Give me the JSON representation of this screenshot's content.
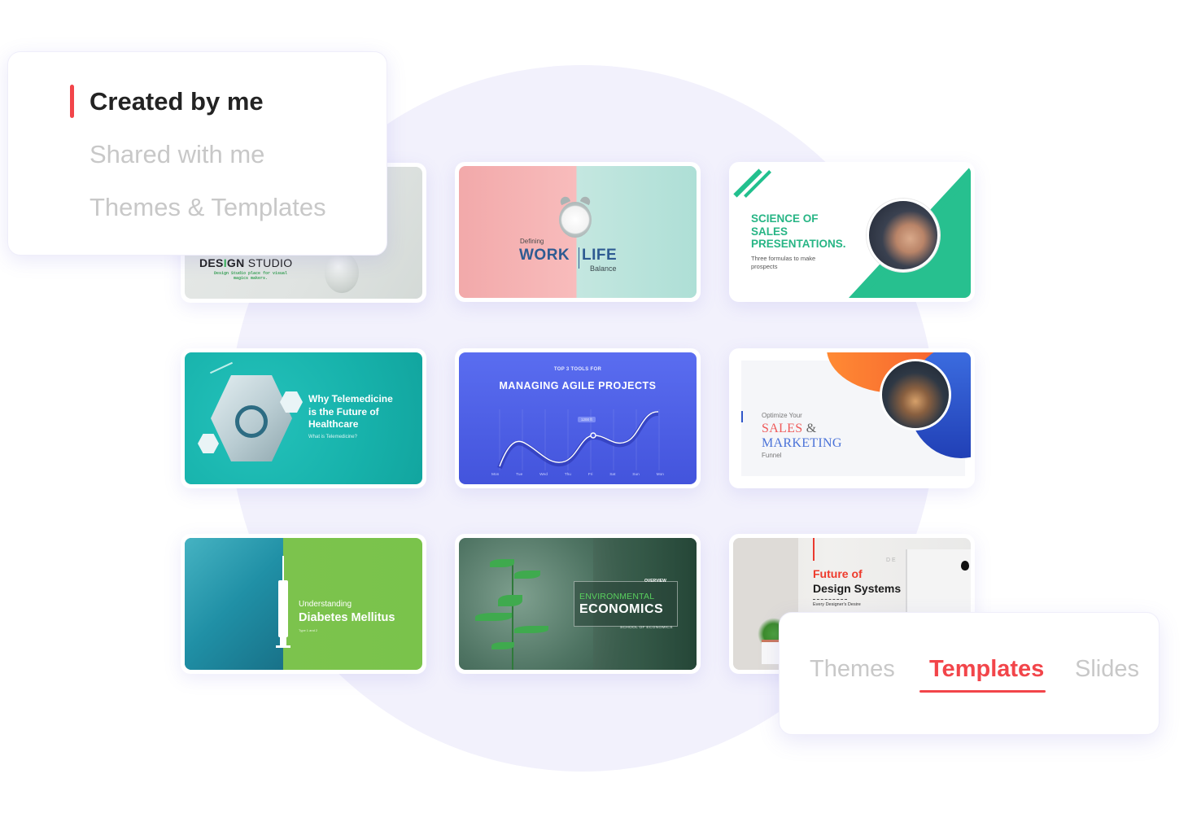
{
  "colors": {
    "accent": "#f2454a",
    "background_circle": "#f2f1fc",
    "inactive_text": "#c8c8c8",
    "active_text": "#232323"
  },
  "filter_panel": {
    "items": [
      {
        "label": "Created by me",
        "active": true
      },
      {
        "label": "Shared with me",
        "active": false
      },
      {
        "label": "Themes & Templates",
        "active": false
      }
    ]
  },
  "tabs_panel": {
    "tabs": [
      {
        "label": "Themes",
        "active": false
      },
      {
        "label": "Templates",
        "active": true
      },
      {
        "label": "Slides",
        "active": false
      }
    ]
  },
  "templates": [
    {
      "id": "design-studio",
      "title_bold": "DES",
      "title_accent": "I",
      "title_bold2": "GN",
      "title_light": " STUDIO",
      "subtitle": "Design Studio place for visual magics makers."
    },
    {
      "id": "work-life",
      "pre": "Defining",
      "word1": "WORK",
      "word2": "LIFE",
      "post": "Balance"
    },
    {
      "id": "science-of-sales",
      "title_lines": [
        "SCIENCE OF",
        "SALES",
        "PRESENTATIONS."
      ],
      "subtitle": "Three formulas to make prospects"
    },
    {
      "id": "telemedicine",
      "title_lines": [
        "Why Telemedicine",
        "is the Future of",
        "Healthcare"
      ],
      "subtitle": "What is Telemedicine?"
    },
    {
      "id": "agile-projects",
      "pre": "TOP 3 TOOLS FOR",
      "title": "MANAGING AGILE PROJECTS",
      "tooltip": "1200 ft",
      "days": [
        "Mon",
        "Tue",
        "Wed",
        "Thu",
        "Fri",
        "Sat",
        "Sun",
        "Mon"
      ]
    },
    {
      "id": "sales-marketing",
      "pre": "Optimize Your",
      "word1": "SALES",
      "amp": " &",
      "word2": "MARKETING",
      "post": "Funnel"
    },
    {
      "id": "diabetes",
      "pre": "Understanding",
      "title": "Diabetes Mellitus",
      "subtitle": "Type 1 and 2"
    },
    {
      "id": "environmental-economics",
      "tag": "OVERVIEW",
      "line1": "ENVIRONMENTAL",
      "line2": "ECONOMICS",
      "sub": "SCHOOL OF ECONOMICS"
    },
    {
      "id": "design-systems",
      "line1": "Future of",
      "line2": "Design Systems",
      "sub": "Every Designer's Desire",
      "bg_text": "DE"
    }
  ]
}
